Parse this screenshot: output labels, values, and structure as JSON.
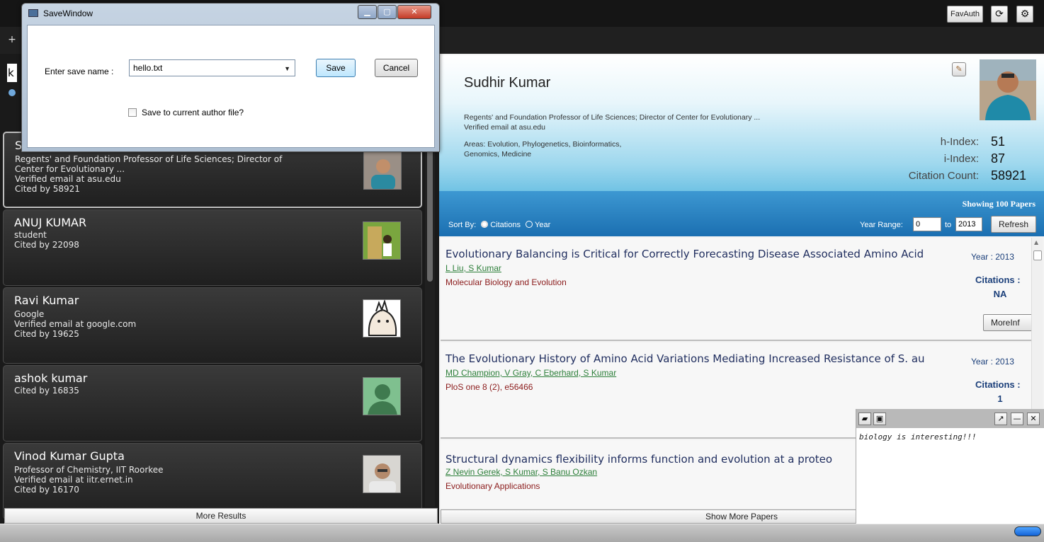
{
  "toolbar": {
    "new_tab": "+",
    "favauth_label": "FavAuth",
    "refresh_icon": "refresh-icon",
    "settings_icon": "gear-icon"
  },
  "search": {
    "value_fragment": "k"
  },
  "authors": [
    {
      "name": "S",
      "info": "Regents' and Foundation Professor of Life Sciences; Director of\nCenter for Evolutionary  ...\nVerified email at asu.edu\nCited by 58921"
    },
    {
      "name": "ANUJ KUMAR",
      "info": "student\nCited by 22098"
    },
    {
      "name": "Ravi Kumar",
      "info": "Google\nVerified email at google.com\nCited by 19625"
    },
    {
      "name": "ashok kumar",
      "info": "Cited by 16835"
    },
    {
      "name": "Vinod Kumar Gupta",
      "info": "Professor of Chemistry, IIT Roorkee\nVerified email at iitr.ernet.in\nCited by 16170"
    }
  ],
  "more_results_label": "More Results",
  "profile": {
    "name": "Sudhir Kumar",
    "affiliation": "Regents' and Foundation Professor of Life Sciences; Director of Center for Evolutionary  ...",
    "email": "Verified email at asu.edu",
    "areas_line1": "Areas: Evolution, Phylogenetics, Bioinformatics,",
    "areas_line2": "Genomics, Medicine",
    "h_index_label": "h-Index:",
    "h_index": "51",
    "i_index_label": "i-Index:",
    "i_index": "87",
    "citation_label": "Citation Count:",
    "citation_count": "58921"
  },
  "papers_bar": {
    "showing": "Showing 100 Papers",
    "sort_by": "Sort By:",
    "sort_citations": "Citations",
    "sort_year": "Year",
    "year_range_label": "Year Range:",
    "year_from": "0",
    "to_label": "to",
    "year_to": "2013",
    "refresh_label": "Refresh"
  },
  "papers": [
    {
      "title": "Evolutionary Balancing is Critical for Correctly Forecasting Disease Associated Amino Acid",
      "authors": "L Liu,  S Kumar",
      "venue": "Molecular Biology and Evolution",
      "year": "Year : 2013",
      "citations_label": "Citations :",
      "citations": "NA",
      "more_label": "MoreInf"
    },
    {
      "title": "The Evolutionary History of Amino Acid Variations Mediating Increased Resistance of S. au",
      "authors": "MD Champion,  V Gray,  C Eberhard,  S Kumar",
      "venue": "PloS one 8 (2), e56466",
      "year": "Year : 2013",
      "citations_label": "Citations :",
      "citations": "1"
    },
    {
      "title": "Structural dynamics flexibility informs function and evolution at a proteo",
      "authors": "Z Nevin Gerek,  S Kumar,  S Banu Ozkan",
      "venue": "Evolutionary Applications"
    }
  ],
  "show_more_papers": "Show More Papers",
  "note": {
    "text": "biology is interesting!!!"
  },
  "dialog": {
    "title": "SaveWindow",
    "label": "Enter save name :",
    "filename": "hello.txt",
    "save_label": "Save",
    "cancel_label": "Cancel",
    "checkbox_label": "Save to current author file?",
    "checkbox_checked": false
  }
}
